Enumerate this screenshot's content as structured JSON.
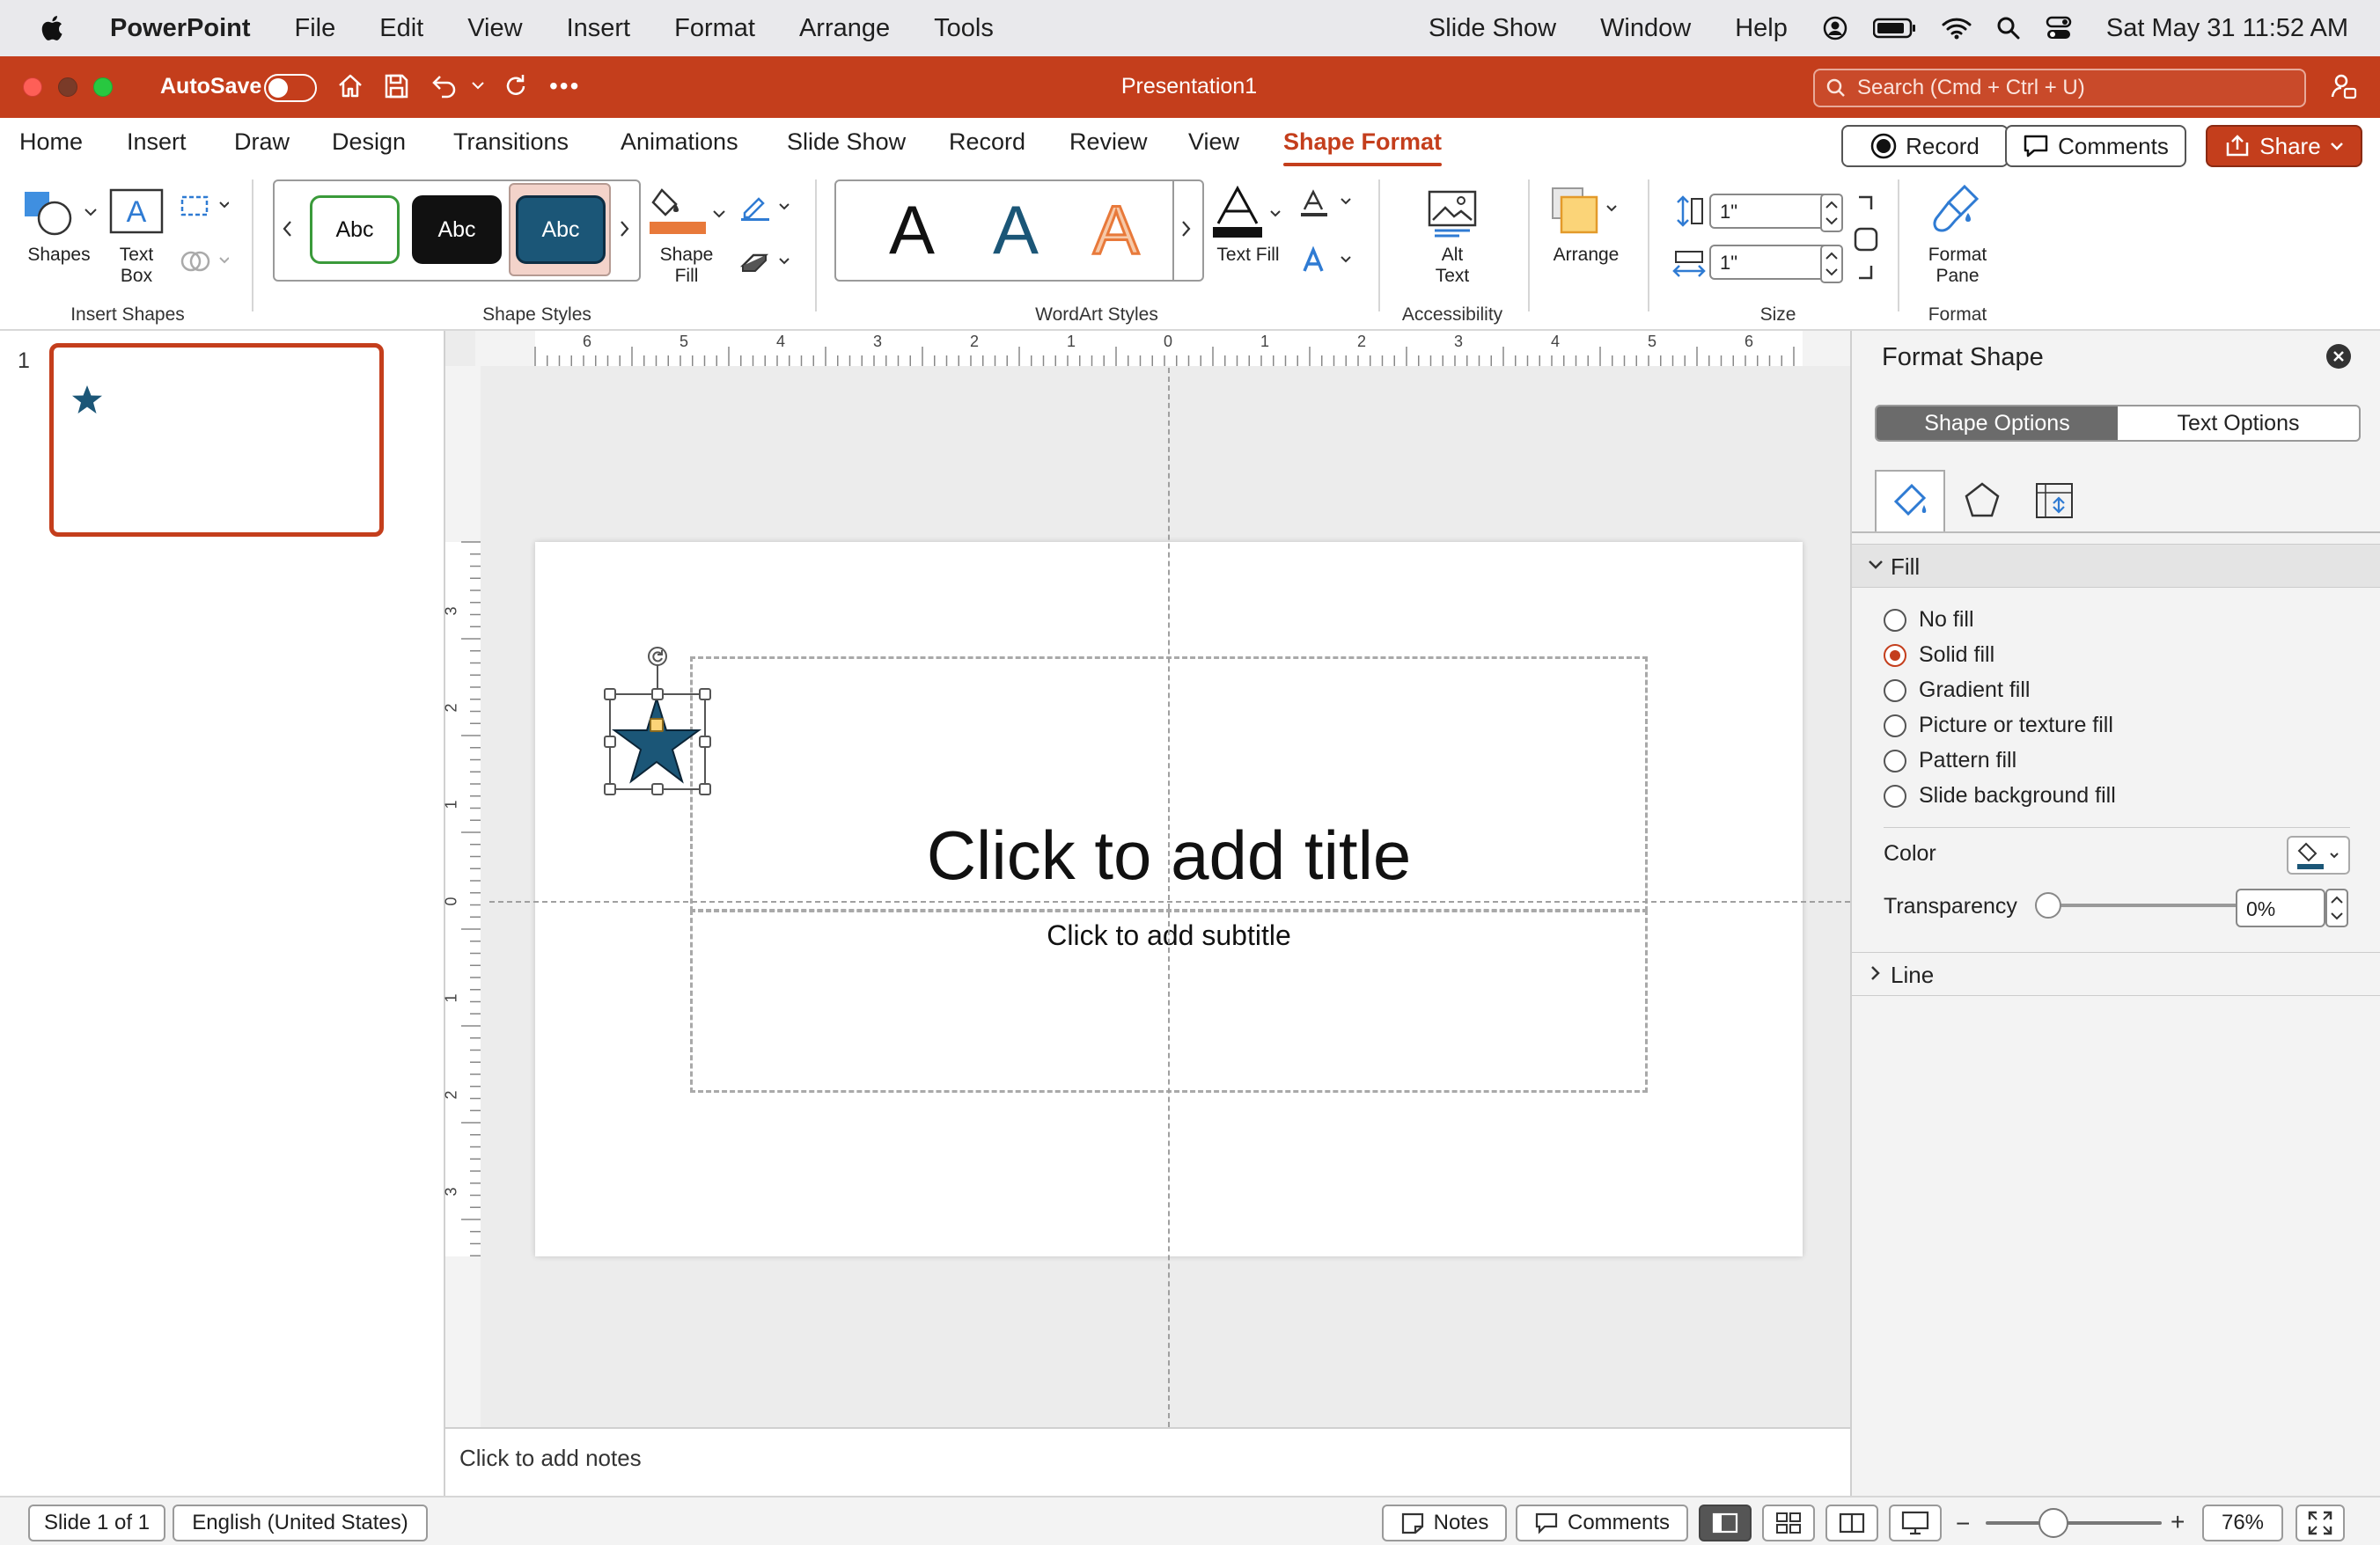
{
  "menubar": {
    "app_name": "PowerPoint",
    "items": [
      "File",
      "Edit",
      "View",
      "Insert",
      "Format",
      "Arrange",
      "Tools"
    ],
    "right_items": [
      "Slide Show",
      "Window",
      "Help"
    ],
    "datetime": "Sat May 31  11:52 AM"
  },
  "titlebar": {
    "autosave_label": "AutoSave",
    "autosave_on": false,
    "document_title": "Presentation1",
    "search_placeholder": "Search (Cmd + Ctrl + U)"
  },
  "tabs": {
    "items": [
      "Home",
      "Insert",
      "Draw",
      "Design",
      "Transitions",
      "Animations",
      "Slide Show",
      "Record",
      "Review",
      "View",
      "Shape Format"
    ],
    "active": "Shape Format",
    "record_button": "Record",
    "comments_button": "Comments",
    "share_button": "Share"
  },
  "ribbon": {
    "insert_shapes": {
      "group_label": "Insert Shapes",
      "shapes_label": "Shapes",
      "textbox_label_1": "Text",
      "textbox_label_2": "Box"
    },
    "shape_styles": {
      "group_label": "Shape Styles",
      "style_samples": [
        "Abc",
        "Abc",
        "Abc"
      ],
      "shape_fill_label_1": "Shape",
      "shape_fill_label_2": "Fill"
    },
    "wordart_styles": {
      "group_label": "WordArt Styles",
      "samples": [
        "A",
        "A",
        "A"
      ],
      "text_fill_label": "Text Fill"
    },
    "accessibility": {
      "group_label": "Accessibility",
      "alt_text_label_1": "Alt",
      "alt_text_label_2": "Text"
    },
    "arrange": {
      "label": "Arrange"
    },
    "size": {
      "group_label": "Size",
      "height_value": "1\"",
      "width_value": "1\""
    },
    "format": {
      "group_label": "Format",
      "format_pane_label_1": "Format",
      "format_pane_label_2": "Pane"
    }
  },
  "thumbnails": {
    "slide_number": "1"
  },
  "rulers": {
    "top_labels": [
      "6",
      "5",
      "4",
      "3",
      "2",
      "1",
      "0",
      "1",
      "2",
      "3",
      "4",
      "5",
      "6"
    ],
    "left_labels": [
      "3",
      "2",
      "1",
      "0",
      "1",
      "2",
      "3"
    ]
  },
  "slide": {
    "title_placeholder": "Click to add title",
    "subtitle_placeholder": "Click to add subtitle",
    "shape_fill_color": "#1b5677"
  },
  "notes": {
    "placeholder": "Click to add notes"
  },
  "format_pane": {
    "title": "Format Shape",
    "tab_shape_options": "Shape Options",
    "tab_text_options": "Text Options",
    "fill_section": "Fill",
    "fill_options": [
      "No fill",
      "Solid fill",
      "Gradient fill",
      "Picture or texture fill",
      "Pattern fill",
      "Slide background fill"
    ],
    "selected_fill": "Solid fill",
    "color_label": "Color",
    "transparency_label": "Transparency",
    "transparency_value": "0%",
    "line_section": "Line"
  },
  "status": {
    "slide_indicator": "Slide 1 of 1",
    "language": "English (United States)",
    "notes_button": "Notes",
    "comments_button": "Comments",
    "zoom": "76%"
  },
  "colors": {
    "accent": "#c43e1c",
    "shape_fill": "#1b5677"
  }
}
